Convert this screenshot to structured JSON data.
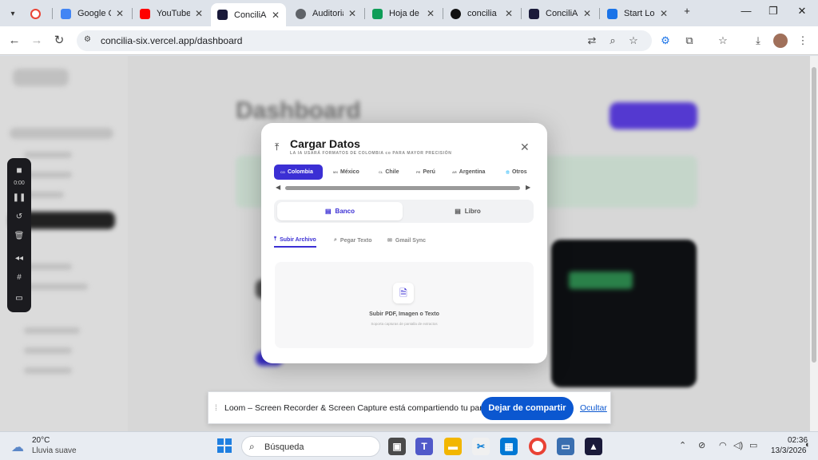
{
  "browser": {
    "tabs": [
      {
        "label": "",
        "color": "#ea4335"
      },
      {
        "label": "Google C",
        "color": "#4285f4"
      },
      {
        "label": "YouTube",
        "color": "#ff0000"
      },
      {
        "label": "ConciliAI",
        "color": "#1a1a3a"
      },
      {
        "label": "Auditoria",
        "color": "#5f6368"
      },
      {
        "label": "Hoja de c",
        "color": "#0f9d58"
      },
      {
        "label": "concilia",
        "color": "#111111"
      },
      {
        "label": "ConciliAI",
        "color": "#1a1a3a"
      },
      {
        "label": "Start Loo",
        "color": "#1a73e8"
      }
    ],
    "url": "concilia-six.vercel.app/dashboard"
  },
  "loom_controls": {
    "timer": "0:00"
  },
  "modal": {
    "title": "Cargar Datos",
    "subtitle": "LA IA USARÁ FORMATOS DE COLOMBIA co PARA MAYOR PRECISIÓN",
    "countries": [
      {
        "code": "CO",
        "name": "Colombia"
      },
      {
        "code": "MX",
        "name": "México"
      },
      {
        "code": "CL",
        "name": "Chile"
      },
      {
        "code": "PE",
        "name": "Perú"
      },
      {
        "code": "AR",
        "name": "Argentina"
      },
      {
        "code": "🌐",
        "name": "Otros"
      }
    ],
    "segments": [
      "Banco",
      "Libro"
    ],
    "subtabs": [
      "Subir Archivo",
      "Pegar Texto",
      "Gmail Sync"
    ],
    "dropzone": {
      "title": "Subir PDF, Imagen o Texto",
      "hint": "Soporta capturas de pantalla de extractos"
    }
  },
  "share_banner": {
    "message": "Loom – Screen Recorder & Screen Capture está compartiendo tu pantalla.",
    "stop_label": "Dejar de compartir",
    "hide_label": "Ocultar"
  },
  "taskbar": {
    "temperature": "20°C",
    "weather": "Lluvia suave",
    "search_placeholder": "Búsqueda",
    "time": "02:36",
    "date": "13/3/2026"
  },
  "colors": {
    "accent": "#3b2fd4",
    "stop_button": "#0b57d0"
  }
}
